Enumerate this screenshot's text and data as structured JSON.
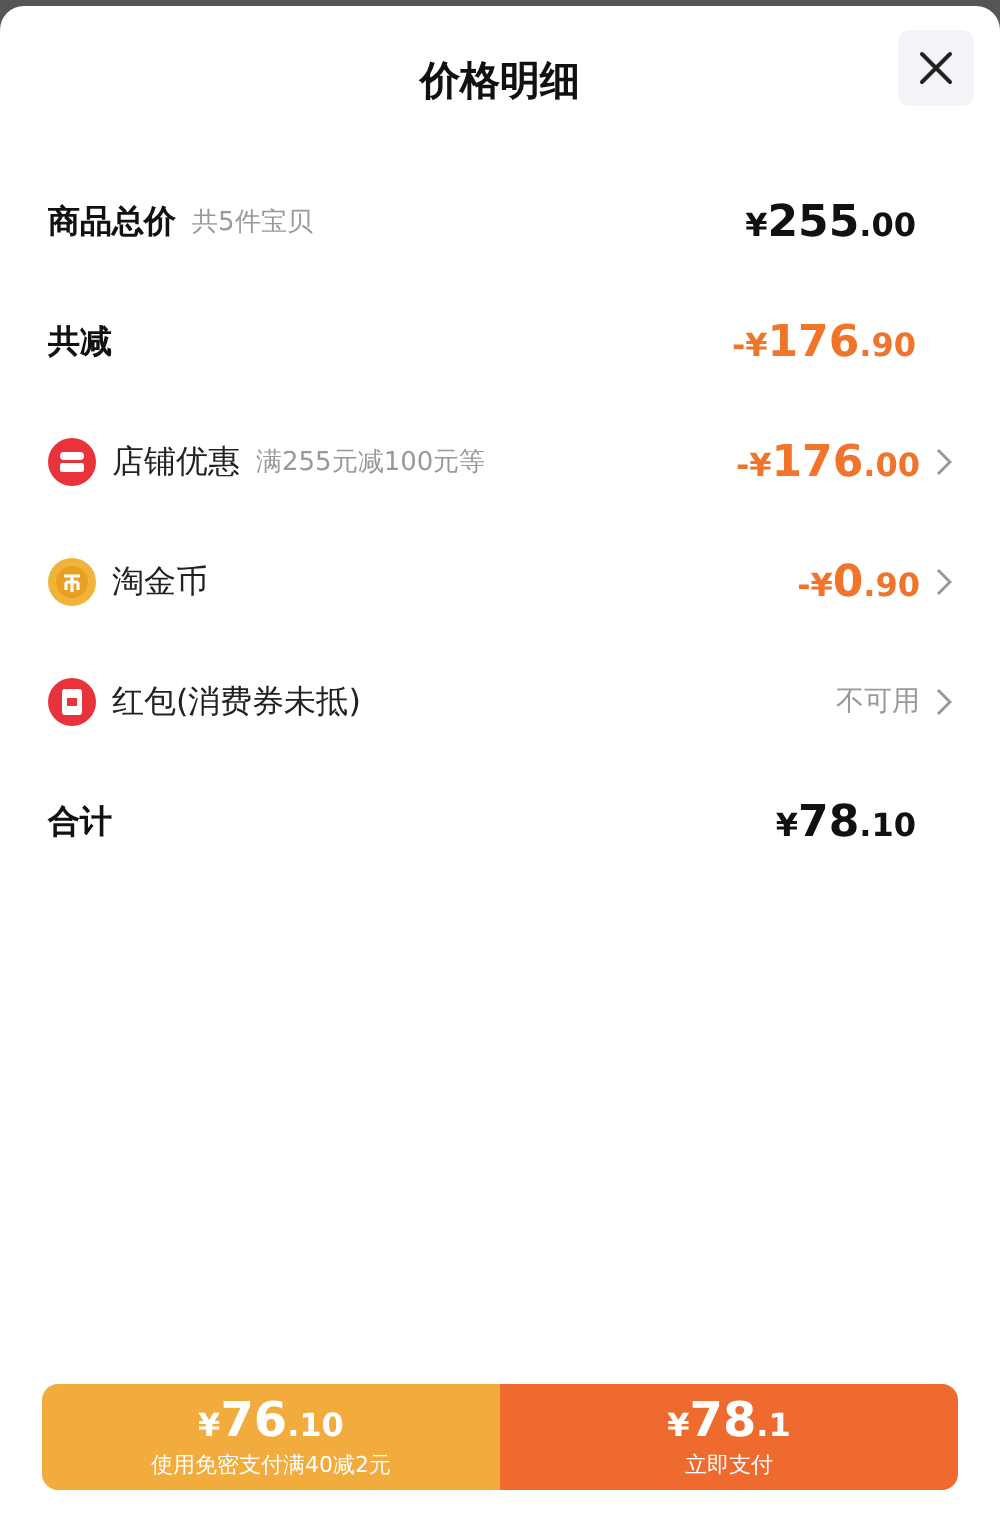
{
  "title": "价格明细",
  "rows": [
    {
      "kind": "plain",
      "label": "商品总价",
      "note": "共5件宝贝",
      "amount": "¥255.00",
      "color": "#111111",
      "chevron": false
    },
    {
      "kind": "plain",
      "label": "共减",
      "amount": "-¥176.90",
      "color": "#f0742a",
      "chevron": false
    },
    {
      "kind": "shop",
      "label": "店铺优惠",
      "note": "满255元减100元等",
      "amount": "-¥176.00",
      "color": "#f0742a",
      "chevron": true
    },
    {
      "kind": "coin",
      "label": "淘金币",
      "amount": "-¥0.90",
      "color": "#f0742a",
      "chevron": true
    },
    {
      "kind": "redpacket",
      "label": "红包(消费券未抵)",
      "status": "不可用",
      "chevron": true
    },
    {
      "kind": "plain",
      "label": "合计",
      "amount": "¥78.10",
      "color": "#111111",
      "chevron": false
    }
  ],
  "buttons": [
    {
      "kind": "secondary",
      "amount": "¥76.10",
      "caption": "使用免密支付满40减2元"
    },
    {
      "kind": "primary",
      "amount": "¥78.1",
      "caption": "立即支付"
    }
  ]
}
